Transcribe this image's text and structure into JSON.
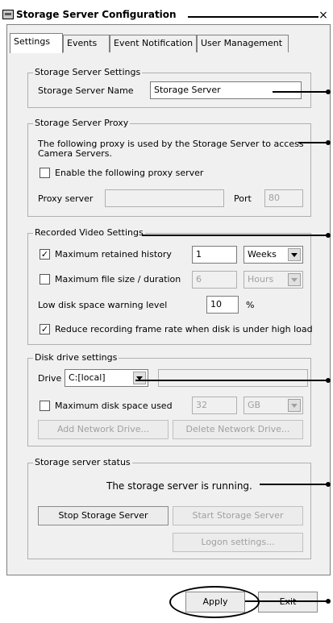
{
  "window": {
    "title": "Storage Server Configuration",
    "close_glyph": "×"
  },
  "tabs": [
    "Settings",
    "Events",
    "Event Notification",
    "User Management"
  ],
  "storage_settings": {
    "legend": "Storage Server Settings",
    "name_label": "Storage Server Name",
    "name_value": "Storage Server"
  },
  "proxy": {
    "legend": "Storage Server Proxy",
    "description_line1": "The following proxy is used by the Storage Server to access",
    "description_line2": "Camera Servers.",
    "enable_label": "Enable the following proxy server",
    "enable_checked": false,
    "server_label": "Proxy server",
    "server_value": "",
    "port_label": "Port",
    "port_value": "80"
  },
  "recorded": {
    "legend": "Recorded Video Settings",
    "history_label": "Maximum retained history",
    "history_checked": true,
    "history_value": "1",
    "history_unit": "Weeks",
    "filesize_label": "Maximum file size / duration",
    "filesize_checked": false,
    "filesize_value": "6",
    "filesize_unit": "Hours",
    "lowdisk_label": "Low disk space warning level",
    "lowdisk_value": "10",
    "lowdisk_unit": "%",
    "reduce_label": "Reduce recording frame rate when disk is under high load",
    "reduce_checked": true
  },
  "disk": {
    "legend": "Disk drive settings",
    "drive_label": "Drive",
    "drive_value": "C:[local]",
    "drive_path": "",
    "maxdisk_label": "Maximum disk space used",
    "maxdisk_checked": false,
    "maxdisk_value": "32",
    "maxdisk_unit": "GB",
    "add_network": "Add Network Drive...",
    "delete_network": "Delete Network Drive..."
  },
  "status": {
    "legend": "Storage server status",
    "message": "The storage server is running.",
    "stop": "Stop Storage Server",
    "start": "Start Storage Server",
    "logon": "Logon settings..."
  },
  "footer": {
    "apply": "Apply",
    "exit": "Exit"
  },
  "colors": {
    "panel_bg": "#f0f0f0",
    "disabled_text": "#a0a0a0",
    "pointer": "#000000"
  }
}
